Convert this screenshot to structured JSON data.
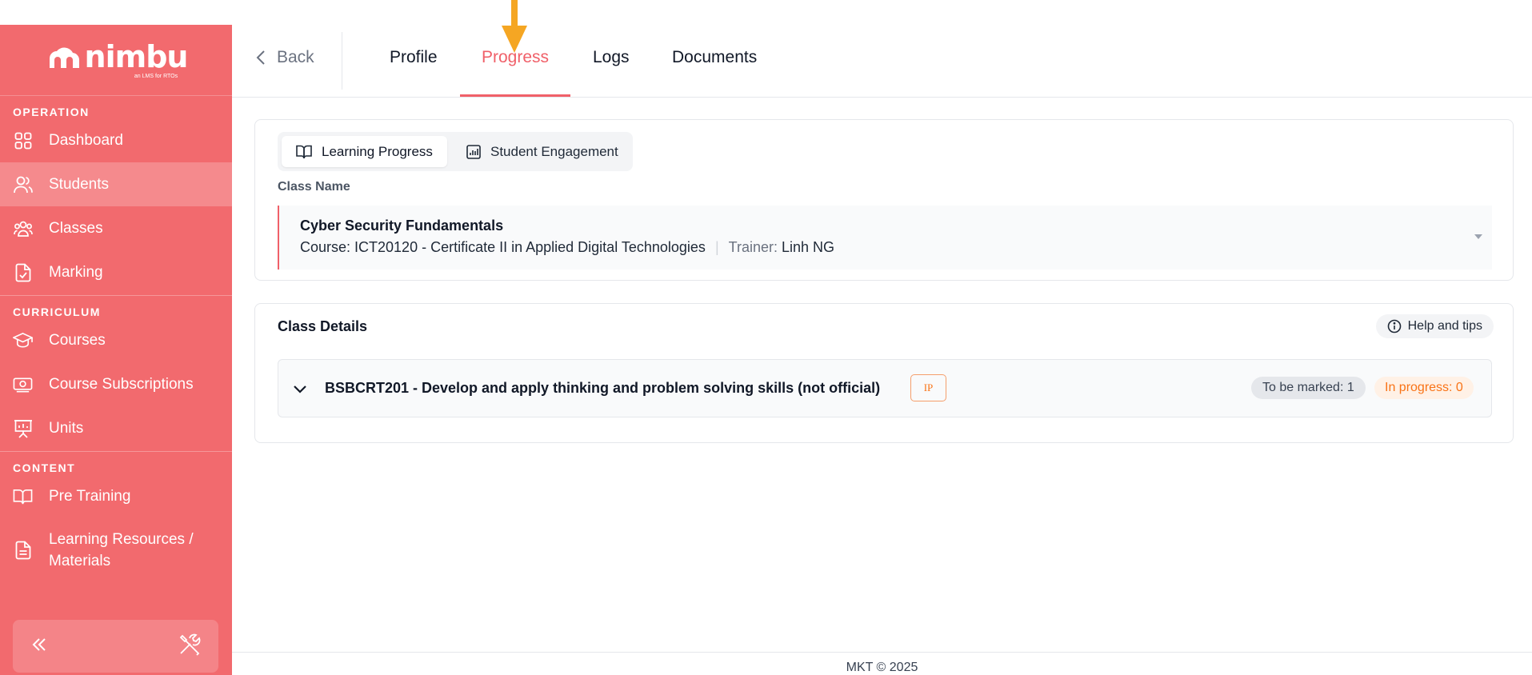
{
  "colors": {
    "brand": "#f26a6e",
    "accent": "#f06069",
    "warning": "#f97316",
    "arrow": "#f5a623"
  },
  "brand": {
    "name": "nimbu",
    "tagline": "an LMS for RTOs"
  },
  "sidebar": {
    "sections": [
      {
        "label": "OPERATION",
        "items": [
          {
            "label": "Dashboard",
            "icon": "dashboard-grid-icon"
          },
          {
            "label": "Students",
            "icon": "users-icon",
            "active": true
          },
          {
            "label": "Classes",
            "icon": "group-icon"
          },
          {
            "label": "Marking",
            "icon": "file-check-icon"
          }
        ]
      },
      {
        "label": "CURRICULUM",
        "items": [
          {
            "label": "Courses",
            "icon": "graduation-cap-icon"
          },
          {
            "label": "Course Subscriptions",
            "icon": "subscription-icon"
          },
          {
            "label": "Units",
            "icon": "presentation-icon"
          }
        ]
      },
      {
        "label": "CONTENT",
        "items": [
          {
            "label": "Pre Training",
            "icon": "book-open-icon"
          },
          {
            "label": "Learning Resources / Materials",
            "icon": "document-icon"
          }
        ]
      }
    ]
  },
  "header": {
    "back_label": "Back",
    "tabs": [
      {
        "label": "Profile"
      },
      {
        "label": "Progress",
        "active": true
      },
      {
        "label": "Logs"
      },
      {
        "label": "Documents"
      }
    ]
  },
  "progress": {
    "segments": [
      {
        "label": "Learning Progress",
        "icon": "book-icon",
        "active": true
      },
      {
        "label": "Student Engagement",
        "icon": "bar-chart-icon"
      }
    ],
    "class_name_label": "Class Name",
    "class": {
      "title": "Cyber Security Fundamentals",
      "course_text": "Course: ICT20120 - Certificate II in Applied Digital Technologies",
      "trainer_label": "Trainer:",
      "trainer_name": "Linh NG"
    }
  },
  "class_details": {
    "title": "Class Details",
    "help_label": "Help and tips",
    "units": [
      {
        "title": "BSBCRT201 - Develop and apply thinking and problem solving skills (not official)",
        "badge": "IP",
        "to_be_marked": "To be marked: 1",
        "in_progress": "In progress: 0"
      }
    ]
  },
  "footer": {
    "text": "MKT © 2025"
  }
}
